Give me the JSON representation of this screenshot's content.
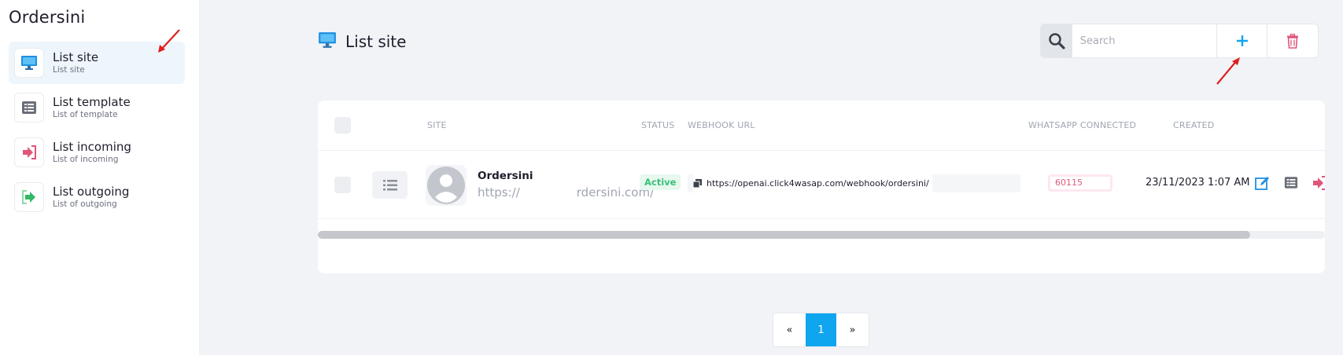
{
  "sidebar": {
    "brand": "Ordersini",
    "items": [
      {
        "title": "List site",
        "subtitle": "List site",
        "icon": "monitor-icon"
      },
      {
        "title": "List template",
        "subtitle": "List of template",
        "icon": "list-template-icon"
      },
      {
        "title": "List incoming",
        "subtitle": "List of incoming",
        "icon": "sign-in-icon"
      },
      {
        "title": "List outgoing",
        "subtitle": "List of outgoing",
        "icon": "sign-out-icon"
      }
    ]
  },
  "header": {
    "title": "List site",
    "search_placeholder": "Search"
  },
  "table": {
    "columns": [
      "SITE",
      "STATUS",
      "WEBHOOK URL",
      "WHATSAPP CONNECTED",
      "CREATED"
    ],
    "rows": [
      {
        "site_name": "Ordersini",
        "site_url_prefix": "https://",
        "site_url_suffix": "rdersini.com/",
        "status": "Active",
        "webhook_url": "https://openai.click4wasap.com/webhook/ordersini/",
        "whatsapp": "60115",
        "created": "23/11/2023 1:07 AM"
      }
    ]
  },
  "pagination": {
    "prev": "«",
    "current": "1",
    "next": "»"
  },
  "colors": {
    "accent": "#10a5ef",
    "active_green": "#3cbf7b",
    "danger_red": "#e35a7b",
    "annotation_red": "#e02020"
  }
}
